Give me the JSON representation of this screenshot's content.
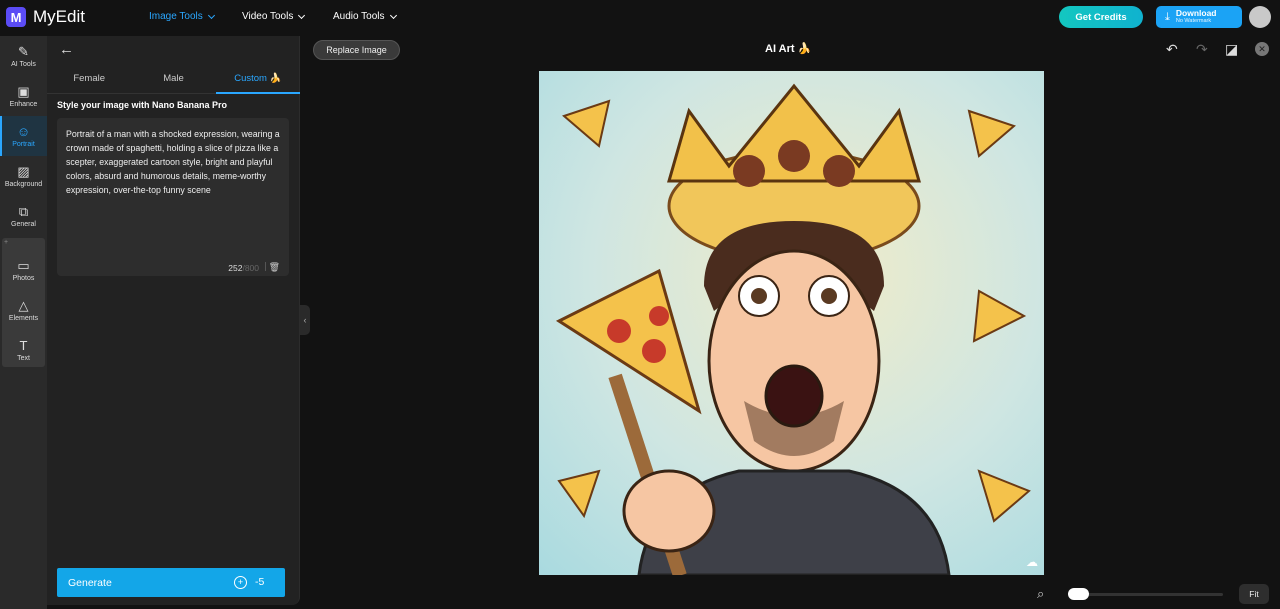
{
  "app": {
    "name": "MyEdit",
    "logo_glyph": "M",
    "brand_color": "#5b4cf5",
    "accent": "#2aa7ff"
  },
  "nav": [
    {
      "label": "Image Tools",
      "active": true
    },
    {
      "label": "Video Tools",
      "active": false
    },
    {
      "label": "Audio Tools",
      "active": false
    }
  ],
  "header": {
    "get_credits": "Get Credits",
    "download": "Download",
    "download_sub": "No Watermark"
  },
  "rail": {
    "items": [
      {
        "label": "AI Tools",
        "icon": "magic-wand-icon"
      },
      {
        "label": "Enhance",
        "icon": "image-enhance-icon"
      },
      {
        "label": "Portrait",
        "icon": "portrait-icon"
      },
      {
        "label": "Background",
        "icon": "background-icon"
      },
      {
        "label": "General",
        "icon": "general-icon"
      },
      {
        "label": "Photos",
        "icon": "photos-icon"
      },
      {
        "label": "Elements",
        "icon": "elements-icon"
      },
      {
        "label": "Text",
        "icon": "text-icon"
      }
    ]
  },
  "panel": {
    "tabs": [
      "Female",
      "Male",
      "Custom"
    ],
    "active_tab": "Custom",
    "section_title": "Style your image with Nano Banana Pro",
    "prompt": "Portrait of a man with a shocked expression, wearing a crown made of spaghetti, holding a slice of pizza like a scepter, exaggerated cartoon style, bright and playful colors, absurd and humorous details, meme-worthy expression, over-the-top funny scene",
    "char_count": "252",
    "char_max": "/800",
    "generate_label": "Generate",
    "generate_cost": "-5"
  },
  "canvas_toolbar": {
    "replace_image": "Replace Image",
    "title": "AI Art"
  },
  "footer": {
    "fit": "Fit",
    "zoom": 0.05
  }
}
